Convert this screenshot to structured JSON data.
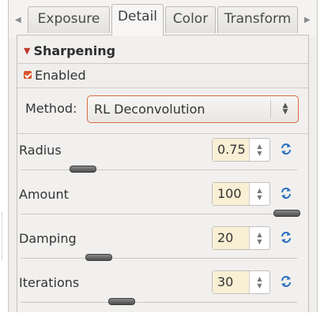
{
  "tabs": [
    {
      "label": "Exposure",
      "active": false
    },
    {
      "label": "Detail",
      "active": true
    },
    {
      "label": "Color",
      "active": false
    },
    {
      "label": "Transform",
      "active": false
    }
  ],
  "section": {
    "title": "Sharpening"
  },
  "enabled": {
    "label": "Enabled",
    "checked": true
  },
  "method": {
    "label": "Method:",
    "value": "RL Deconvolution"
  },
  "adjusters": [
    {
      "label": "Radius",
      "value": "0.75",
      "slider_fraction": 0.2
    },
    {
      "label": "Amount",
      "value": "100",
      "slider_fraction": 1.0
    },
    {
      "label": "Damping",
      "value": "20",
      "slider_fraction": 0.26
    },
    {
      "label": "Iterations",
      "value": "30",
      "slider_fraction": 0.35
    }
  ],
  "colors": {
    "accent": "#d8542a",
    "reset_icon": "#2a6fc0",
    "spin_bg": "#f8efd4"
  }
}
